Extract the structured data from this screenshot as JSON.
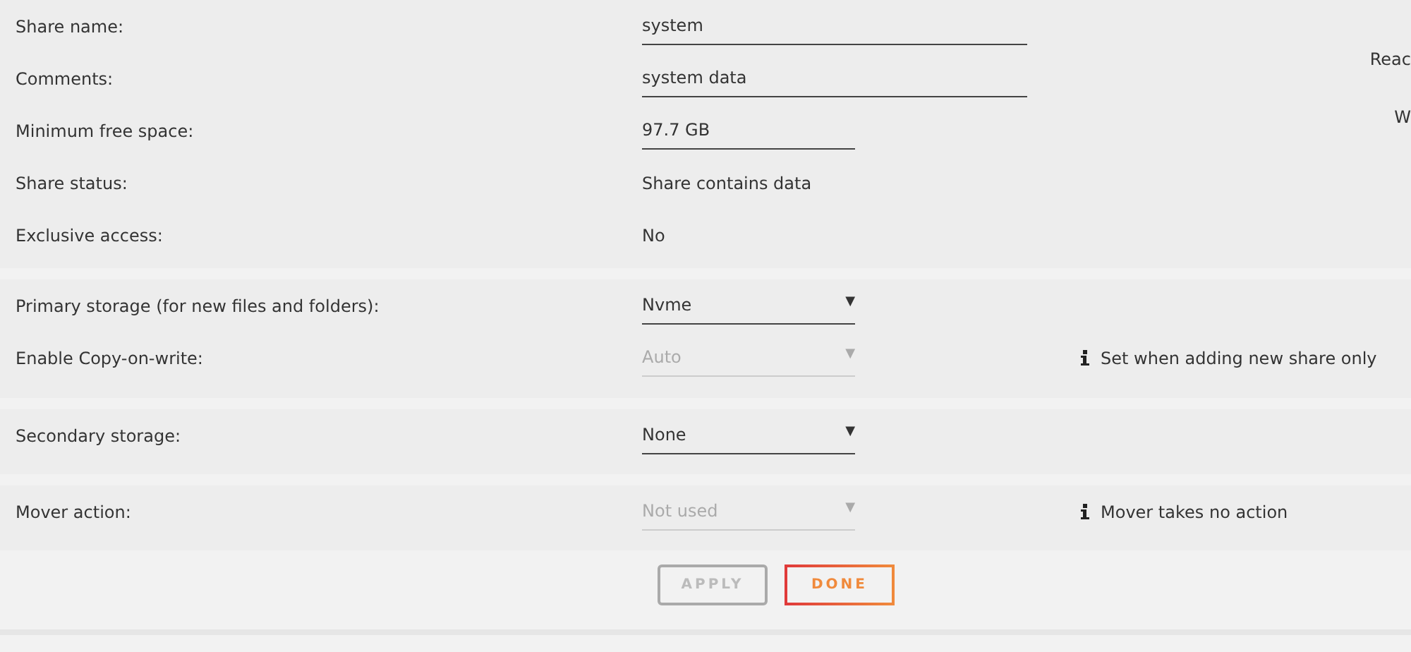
{
  "sections": [
    {
      "rows": [
        {
          "label": "Share name:",
          "kind": "field",
          "value": "system"
        },
        {
          "label": "Comments:",
          "kind": "field",
          "value": "system data",
          "side": "Reac"
        },
        {
          "label": "Minimum free space:",
          "kind": "short-field",
          "value": "97.7 GB",
          "side": "W"
        },
        {
          "label": "Share status:",
          "kind": "text",
          "value": "Share contains data"
        },
        {
          "label": "Exclusive access:",
          "kind": "text",
          "value": "No"
        }
      ]
    },
    {
      "rows": [
        {
          "label": "Primary storage (for new files and folders):",
          "kind": "select",
          "value": "Nvme",
          "arrow": "▼",
          "disabled": false
        },
        {
          "label": "Enable Copy-on-write:",
          "kind": "select",
          "value": "Auto",
          "arrow": "▼",
          "disabled": true,
          "note": "Set when adding new share only"
        }
      ]
    },
    {
      "rows": [
        {
          "label": "Secondary storage:",
          "kind": "select",
          "value": "None",
          "arrow": "▼",
          "disabled": false
        }
      ]
    },
    {
      "rows": [
        {
          "label": "Mover action:",
          "kind": "select",
          "value": "Not used",
          "arrow": "▼",
          "disabled": true,
          "note": "Mover takes no action"
        }
      ]
    }
  ],
  "buttons": [
    {
      "label": "APPLY",
      "disabled": true
    },
    {
      "label": "DONE",
      "disabled": false
    }
  ]
}
